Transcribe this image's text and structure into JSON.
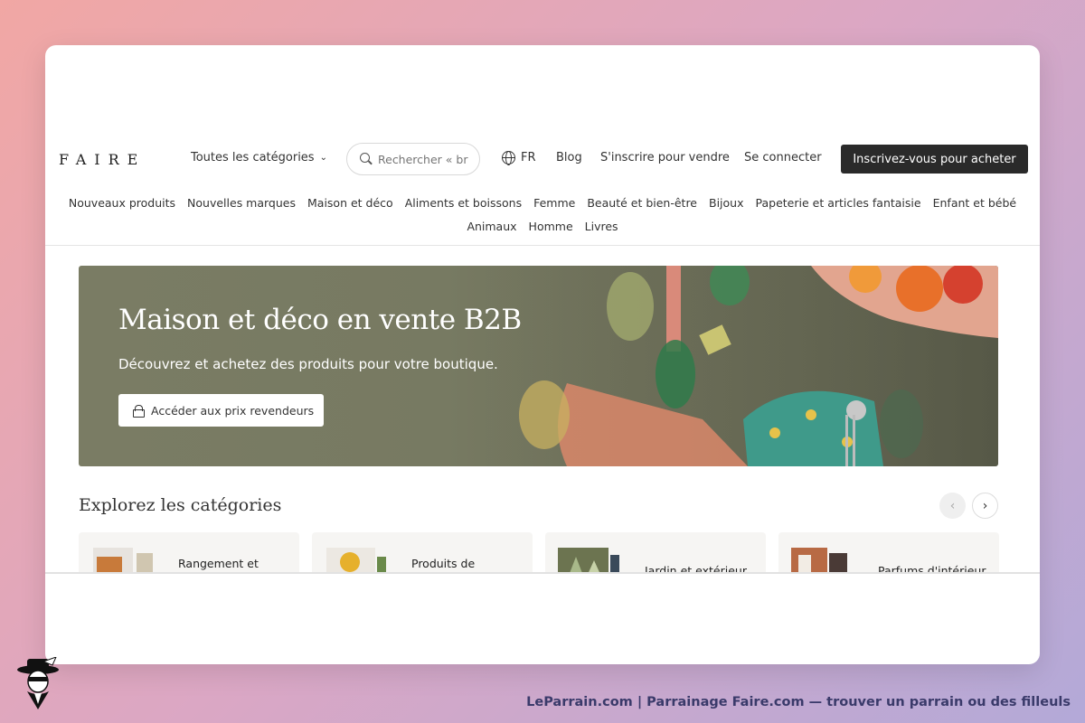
{
  "header": {
    "logo": "FAIRE",
    "categories_dropdown": "Toutes les catégories",
    "search_placeholder": "Rechercher « br",
    "language": "FR",
    "blog": "Blog",
    "sell": "S'inscrire pour vendre",
    "login": "Se connecter",
    "cta": "Inscrivez-vous pour acheter"
  },
  "nav": {
    "row1": [
      "Nouveaux produits",
      "Nouvelles marques",
      "Maison et déco",
      "Aliments et boissons",
      "Femme",
      "Beauté et bien-être",
      "Bijoux",
      "Papeterie et articles fantaisie",
      "Enfant et bébé"
    ],
    "row2": [
      "Animaux",
      "Homme",
      "Livres"
    ]
  },
  "hero": {
    "title": "Maison et déco en vente B2B",
    "subtitle": "Découvrez et achetez des produits pour votre boutique.",
    "button": "Accéder aux prix revendeurs"
  },
  "explore": {
    "title": "Explorez les catégories",
    "cards": [
      "Rangement et",
      "Produits de",
      "Jardin et extérieur",
      "Parfums d'intérieur"
    ]
  },
  "footer": {
    "text": "LeParrain.com | Parrainage Faire.com — trouver un parrain ou des filleuls"
  },
  "icons": [
    "chevron-down-icon",
    "search-icon",
    "globe-icon",
    "lock-icon",
    "chevron-left-icon",
    "chevron-right-icon"
  ],
  "colors": {
    "cta_background": "#2a2a2a",
    "hero_background": "#777a62",
    "card_background": "#f6f5f3"
  }
}
